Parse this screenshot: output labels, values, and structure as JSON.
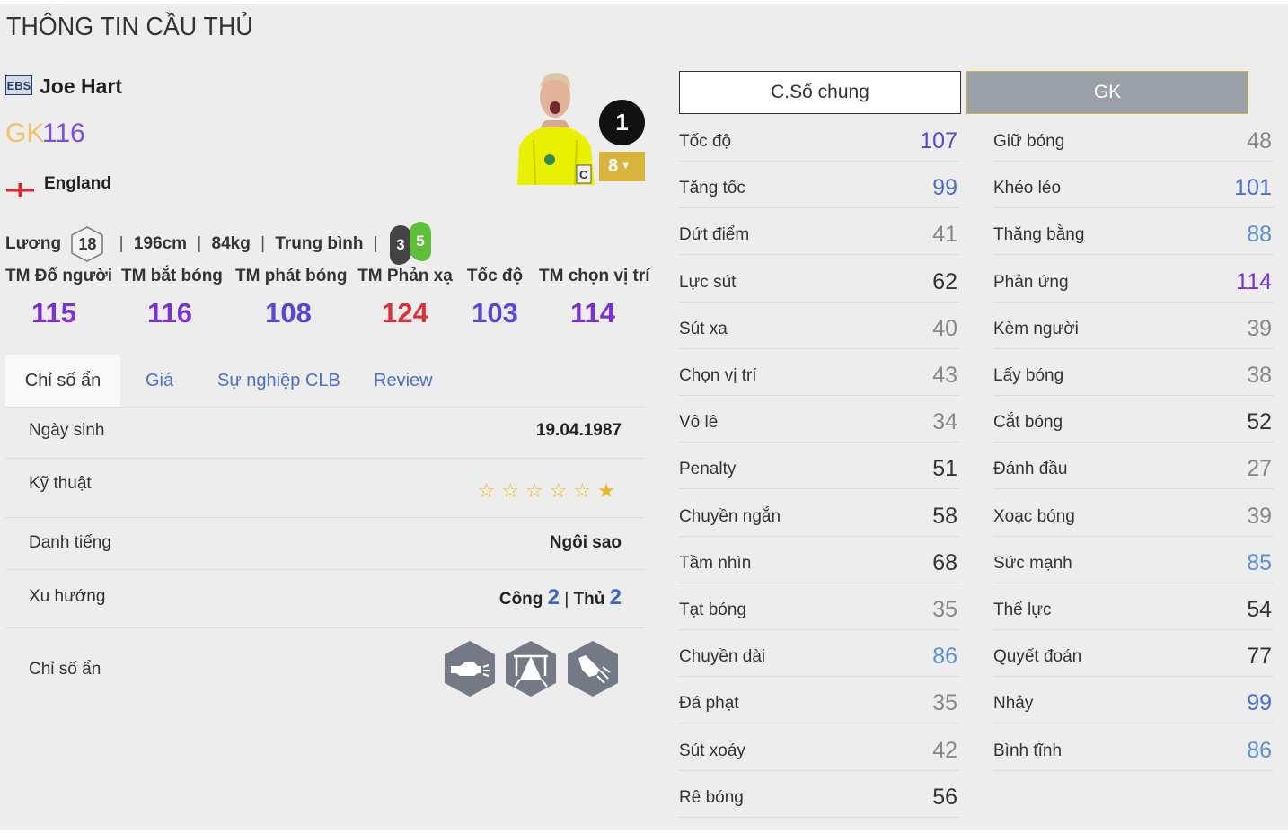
{
  "page": {
    "title": "THÔNG TIN CẦU THỦ"
  },
  "player": {
    "season_badge": "EBS",
    "name": "Joe Hart",
    "position": "GK",
    "ovr": "116",
    "country": "England",
    "jersey_number": "1",
    "upgrade_level": "8",
    "info": {
      "salary_label": "Lương",
      "salary": "18",
      "height": "196cm",
      "weight": "84kg",
      "body_type": "Trung bình",
      "weak_foot": "3",
      "strong_foot": "5"
    },
    "gk_stats": [
      {
        "label": "TM Đổ người",
        "value": "115",
        "color": "#7b2fd6"
      },
      {
        "label": "TM bắt bóng",
        "value": "116",
        "color": "#7b2fd6"
      },
      {
        "label": "TM phát bóng",
        "value": "108",
        "color": "#5a45d9"
      },
      {
        "label": "TM Phản xạ",
        "value": "124",
        "color": "#d8323a"
      },
      {
        "label": "Tốc độ",
        "value": "103",
        "color": "#5a45d9"
      },
      {
        "label": "TM chọn vị trí",
        "value": "114",
        "color": "#7b2fd6"
      }
    ]
  },
  "tabs": [
    {
      "label": "Chỉ số ẩn",
      "active": true
    },
    {
      "label": "Giá",
      "active": false
    },
    {
      "label": "Sự nghiệp CLB",
      "active": false
    },
    {
      "label": "Review",
      "active": false
    }
  ],
  "details": {
    "birthday_label": "Ngày sinh",
    "birthday": "19.04.1987",
    "skill_label": "Kỹ thuật",
    "skill_stars_filled": 1,
    "skill_stars_total": 6,
    "reputation_label": "Danh tiếng",
    "reputation": "Ngôi sao",
    "workrate_label": "Xu hướng",
    "attack_label": "Công",
    "attack_value": "2",
    "defense_label": "Thủ",
    "defense_value": "2",
    "hidden_label": "Chỉ số ẩn",
    "hidden_icons": [
      "punch-icon",
      "goalkeeper-icon",
      "glove-throw-icon"
    ]
  },
  "stat_buttons": {
    "general": "C.Số chung",
    "gk": "GK"
  },
  "stats_left": [
    {
      "label": "Tốc độ",
      "value": "107",
      "color": "#5a45d9"
    },
    {
      "label": "Tăng tốc",
      "value": "99",
      "color": "#4a6fd0"
    },
    {
      "label": "Dứt điểm",
      "value": "41",
      "color": "#888888"
    },
    {
      "label": "Lực sút",
      "value": "62",
      "color": "#333333"
    },
    {
      "label": "Sút xa",
      "value": "40",
      "color": "#888888"
    },
    {
      "label": "Chọn vị trí",
      "value": "43",
      "color": "#888888"
    },
    {
      "label": "Vô lê",
      "value": "34",
      "color": "#888888"
    },
    {
      "label": "Penalty",
      "value": "51",
      "color": "#333333"
    },
    {
      "label": "Chuyền ngắn",
      "value": "58",
      "color": "#333333"
    },
    {
      "label": "Tầm nhìn",
      "value": "68",
      "color": "#333333"
    },
    {
      "label": "Tạt bóng",
      "value": "35",
      "color": "#888888"
    },
    {
      "label": "Chuyền dài",
      "value": "86",
      "color": "#5a90d8"
    },
    {
      "label": "Đá phạt",
      "value": "35",
      "color": "#888888"
    },
    {
      "label": "Sút xoáy",
      "value": "42",
      "color": "#888888"
    },
    {
      "label": "Rê bóng",
      "value": "56",
      "color": "#333333"
    }
  ],
  "stats_right": [
    {
      "label": "Giữ bóng",
      "value": "48",
      "color": "#888888"
    },
    {
      "label": "Khéo léo",
      "value": "101",
      "color": "#4a6fd0"
    },
    {
      "label": "Thăng bằng",
      "value": "88",
      "color": "#5a90d8"
    },
    {
      "label": "Phản ứng",
      "value": "114",
      "color": "#7b2fd6"
    },
    {
      "label": "Kèm người",
      "value": "39",
      "color": "#888888"
    },
    {
      "label": "Lấy bóng",
      "value": "38",
      "color": "#888888"
    },
    {
      "label": "Cắt bóng",
      "value": "52",
      "color": "#333333"
    },
    {
      "label": "Đánh đầu",
      "value": "27",
      "color": "#888888"
    },
    {
      "label": "Xoạc bóng",
      "value": "39",
      "color": "#888888"
    },
    {
      "label": "Sức mạnh",
      "value": "85",
      "color": "#5a90d8"
    },
    {
      "label": "Thể lực",
      "value": "54",
      "color": "#333333"
    },
    {
      "label": "Quyết đoán",
      "value": "77",
      "color": "#333333"
    },
    {
      "label": "Nhảy",
      "value": "99",
      "color": "#4a6fd0"
    },
    {
      "label": "Bình tĩnh",
      "value": "86",
      "color": "#5a90d8"
    }
  ]
}
